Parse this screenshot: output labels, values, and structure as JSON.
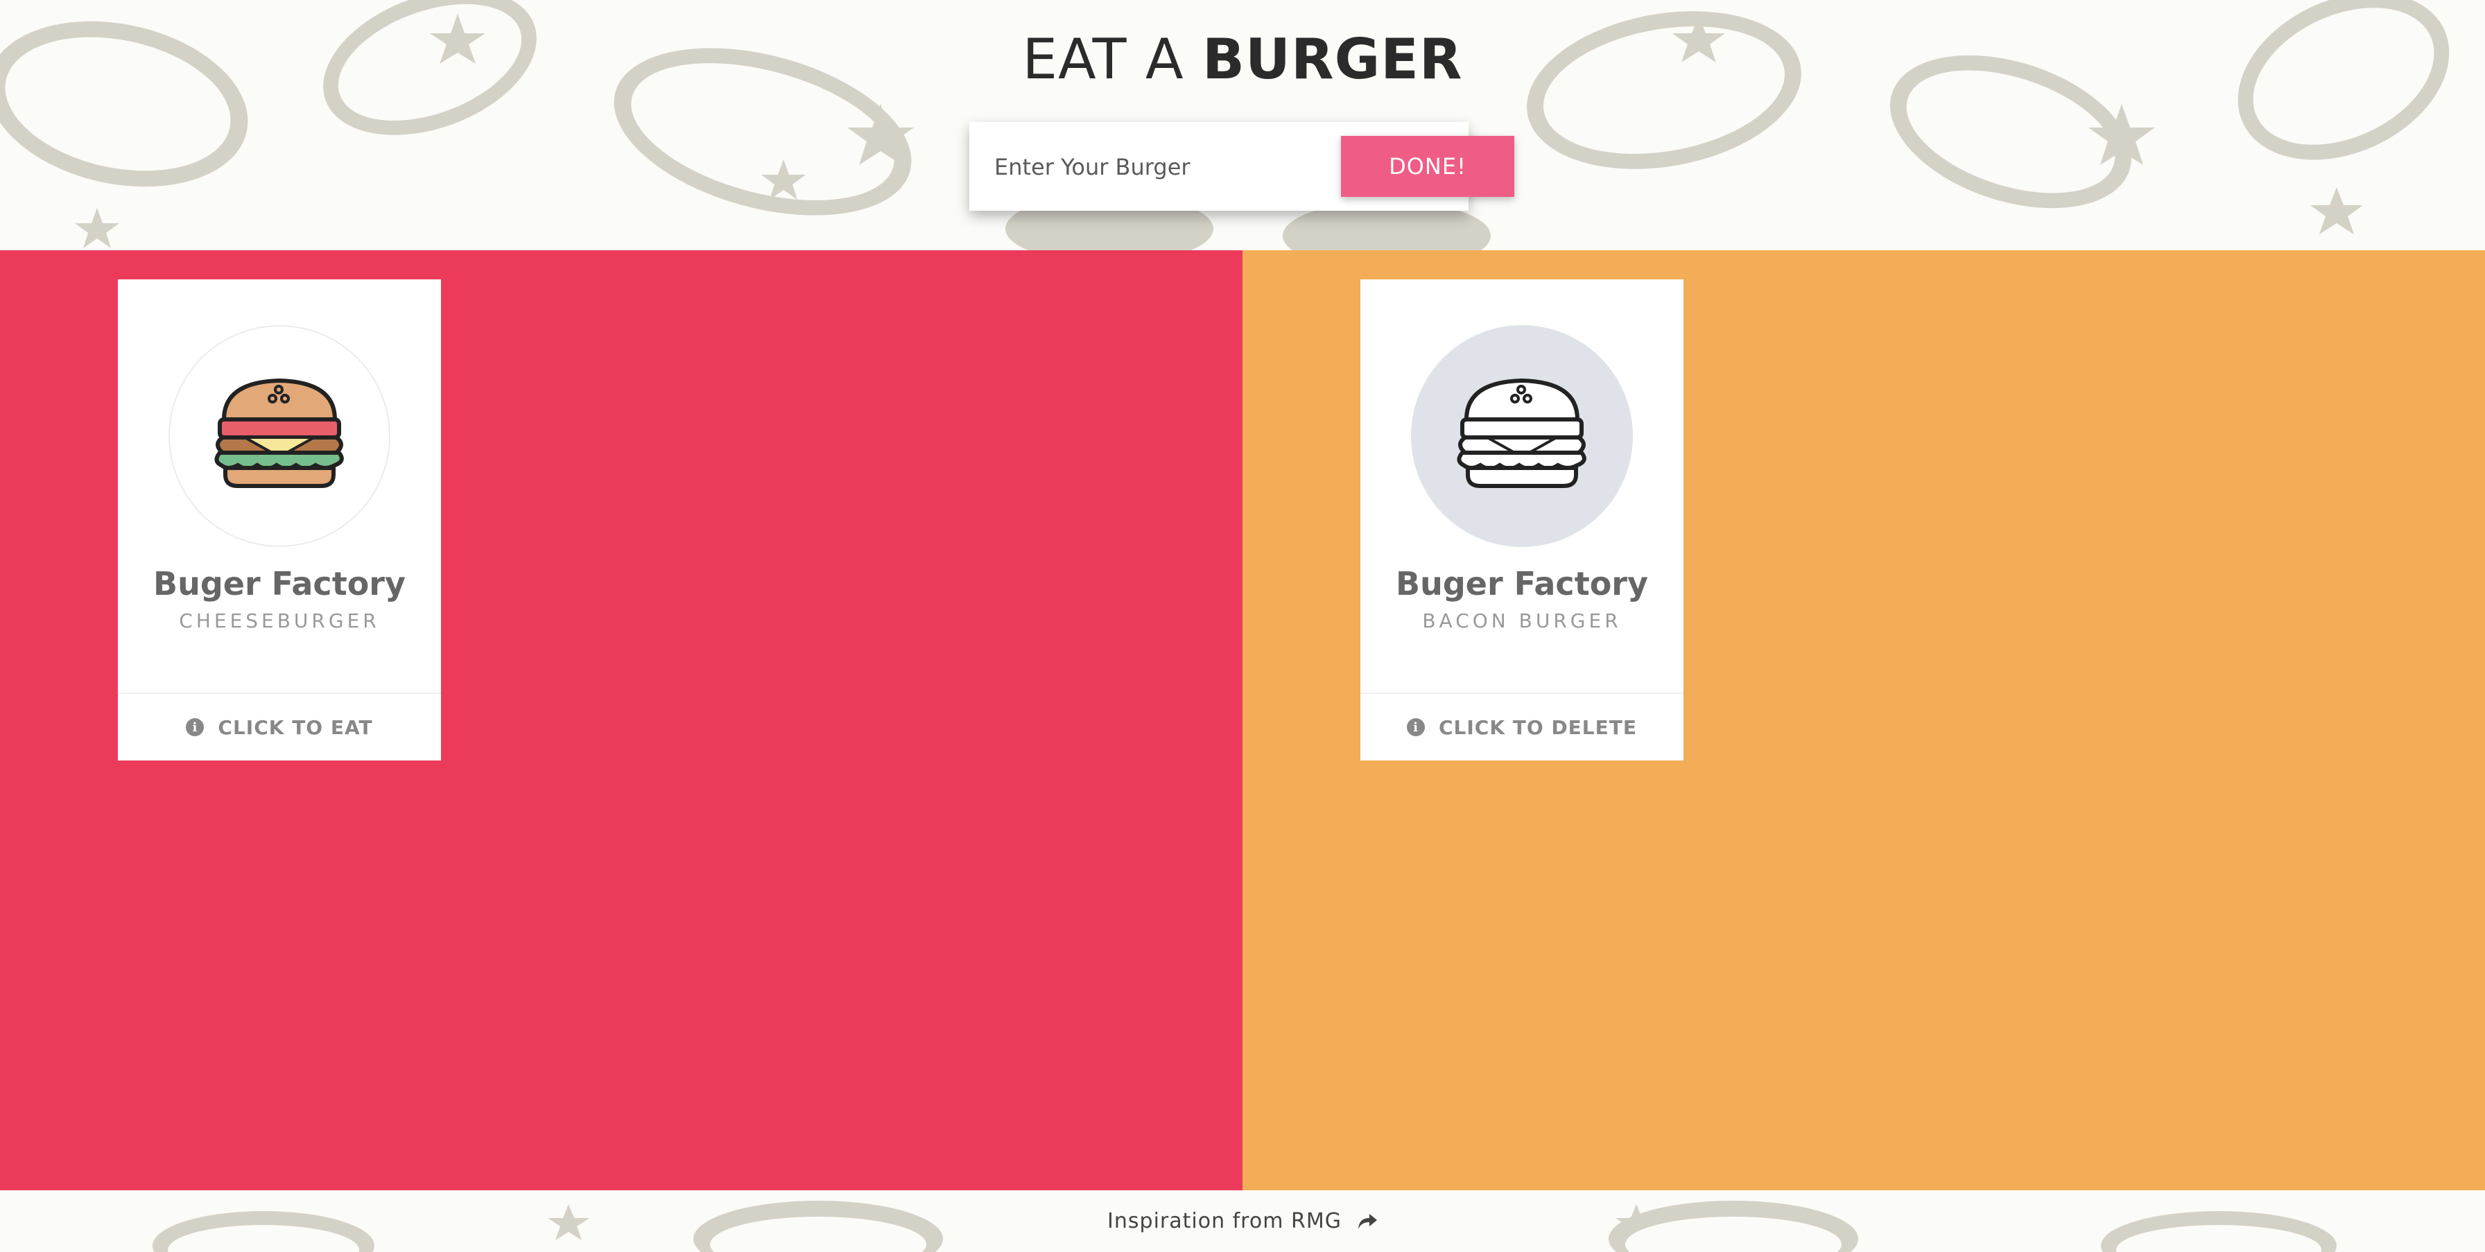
{
  "header": {
    "title_regular": "EAT A",
    "title_bold": "BURGER",
    "input_placeholder": "Enter Your Burger",
    "done_label": "DONE!"
  },
  "columns": [
    {
      "background": "#ec3b5a",
      "card": {
        "name": "Buger Factory",
        "type": "CHEESEBURGER",
        "action": "CLICK TO EAT",
        "icon": "cheeseburger-icon",
        "action_icon": "info-icon"
      }
    },
    {
      "background": "#f3ad56",
      "card": {
        "name": "Buger Factory",
        "type": "BACON BURGER",
        "action": "CLICK TO DELETE",
        "icon": "burger-outline-icon",
        "action_icon": "info-icon"
      }
    }
  ],
  "footer": {
    "link_text": "Inspiration from RMG",
    "icon": "share-arrow-icon"
  },
  "colors": {
    "accent_button": "#ef5c85",
    "pattern": "#d4d1c7"
  }
}
